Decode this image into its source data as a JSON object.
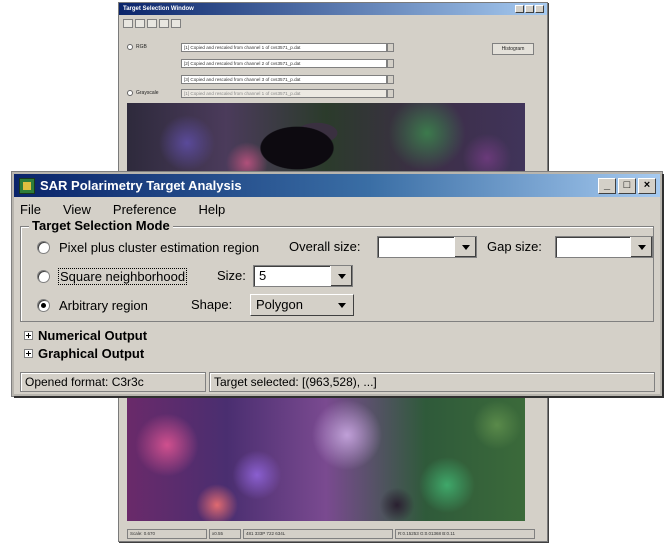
{
  "background_window": {
    "title": "Target Selection Window",
    "rgb_label": "RGB",
    "grayscale_label": "Grayscale",
    "channels": [
      "[1] Copied and rescaled from channel 1 of cvs3571_p.dat",
      "[2] Copied and rescaled from channel 2 of cvs3571_p.dat",
      "[3] Copied and rescaled from channel 3 of cvs3571_p.dat",
      "[1] Copied and rescaled from channel 1 of cvs3571_p.dat"
    ],
    "histogram_button": "Histogram",
    "status": {
      "scale": "Scale: 0.670",
      "zoom": "x0.55",
      "coords": "481 333P 722 634L",
      "value": "R:0.15253 G:0.01368 B:0.11"
    }
  },
  "dialog": {
    "title": "SAR Polarimetry Target Analysis",
    "menu": [
      "File",
      "View",
      "Preference",
      "Help"
    ],
    "mode_group_title": "Target Selection Mode",
    "options": {
      "pixel_cluster": "Pixel plus cluster estimation region",
      "square": "Square neighborhood",
      "arbitrary": "Arbitrary region"
    },
    "overall_size_label": "Overall size:",
    "overall_size_value": "",
    "gap_size_label": "Gap size:",
    "gap_size_value": "",
    "size_label": "Size:",
    "size_value": "5",
    "shape_label": "Shape:",
    "shape_value": "Polygon",
    "selected_option": "arbitrary",
    "numerical_output": "Numerical Output",
    "graphical_output": "Graphical Output",
    "status_format": "Opened format: C3r3c",
    "status_target": "Target selected: [(963,528), ...]"
  },
  "colors": {
    "titlebar_start": "#0a246a",
    "titlebar_end": "#a6caf0",
    "window_face": "#d4d0c8"
  }
}
